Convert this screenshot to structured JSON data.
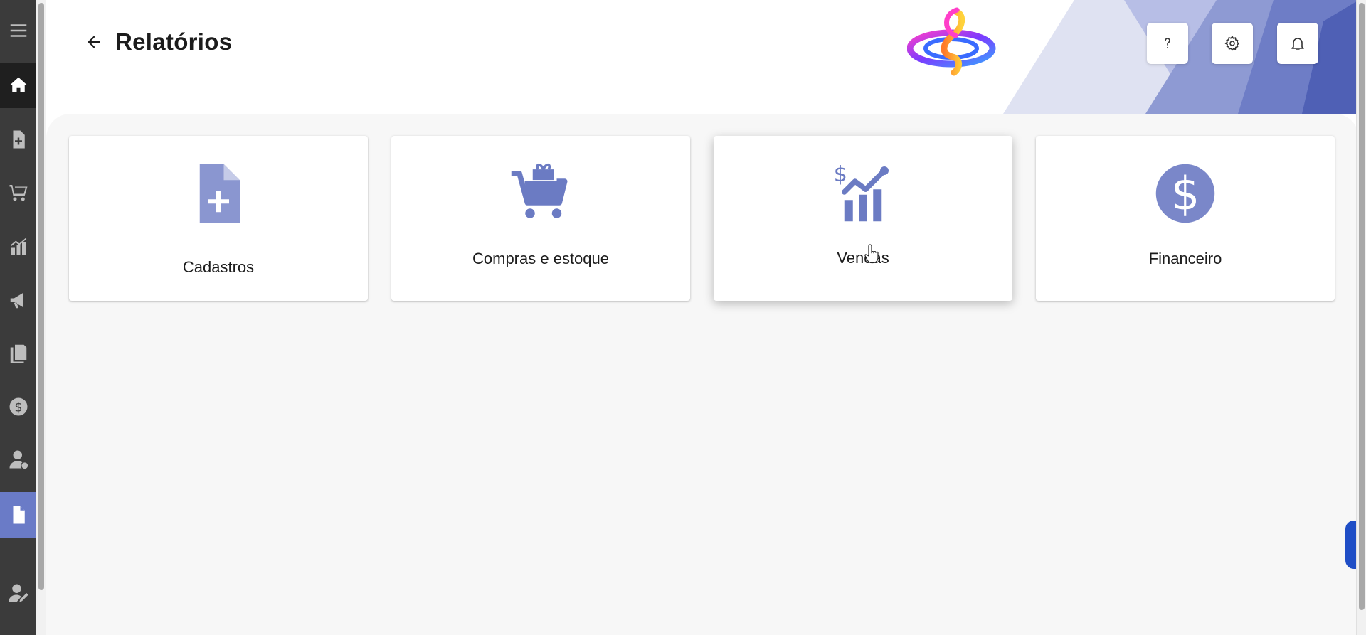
{
  "header": {
    "title": "Relatórios",
    "back_icon": "arrow-left-icon",
    "buttons": [
      {
        "name": "help-button",
        "icon": "question-icon",
        "label": "?"
      },
      {
        "name": "settings-button",
        "icon": "gear-icon"
      },
      {
        "name": "notifications-button",
        "icon": "bell-icon"
      }
    ]
  },
  "sidebar": {
    "items": [
      {
        "name": "menu",
        "icon": "hamburger-icon"
      },
      {
        "name": "home",
        "icon": "home-icon"
      },
      {
        "name": "cadastros",
        "icon": "file-plus-icon"
      },
      {
        "name": "compras",
        "icon": "cart-icon"
      },
      {
        "name": "vendas",
        "icon": "chart-icon"
      },
      {
        "name": "marketing",
        "icon": "megaphone-icon"
      },
      {
        "name": "documentos",
        "icon": "documents-icon"
      },
      {
        "name": "financeiro",
        "icon": "dollar-circle-icon"
      },
      {
        "name": "clientes",
        "icon": "user-money-icon"
      },
      {
        "name": "relatorios",
        "icon": "document-icon",
        "active": true
      },
      {
        "name": "perfil",
        "icon": "user-edit-icon"
      }
    ]
  },
  "cards": [
    {
      "label": "Cadastros",
      "icon": "file-plus-icon"
    },
    {
      "label": "Compras e estoque",
      "icon": "cart-gift-icon"
    },
    {
      "label": "Vendas",
      "icon": "sales-chart-icon"
    },
    {
      "label": "Financeiro",
      "icon": "dollar-circle-icon"
    }
  ],
  "colors": {
    "accent": "#6a7bc7",
    "icon": "#6b7bc3",
    "sidebar_bg": "#3b3b3b",
    "chat": "#1f4ec6"
  },
  "chat": {
    "icon": "chat-bubble-icon"
  }
}
